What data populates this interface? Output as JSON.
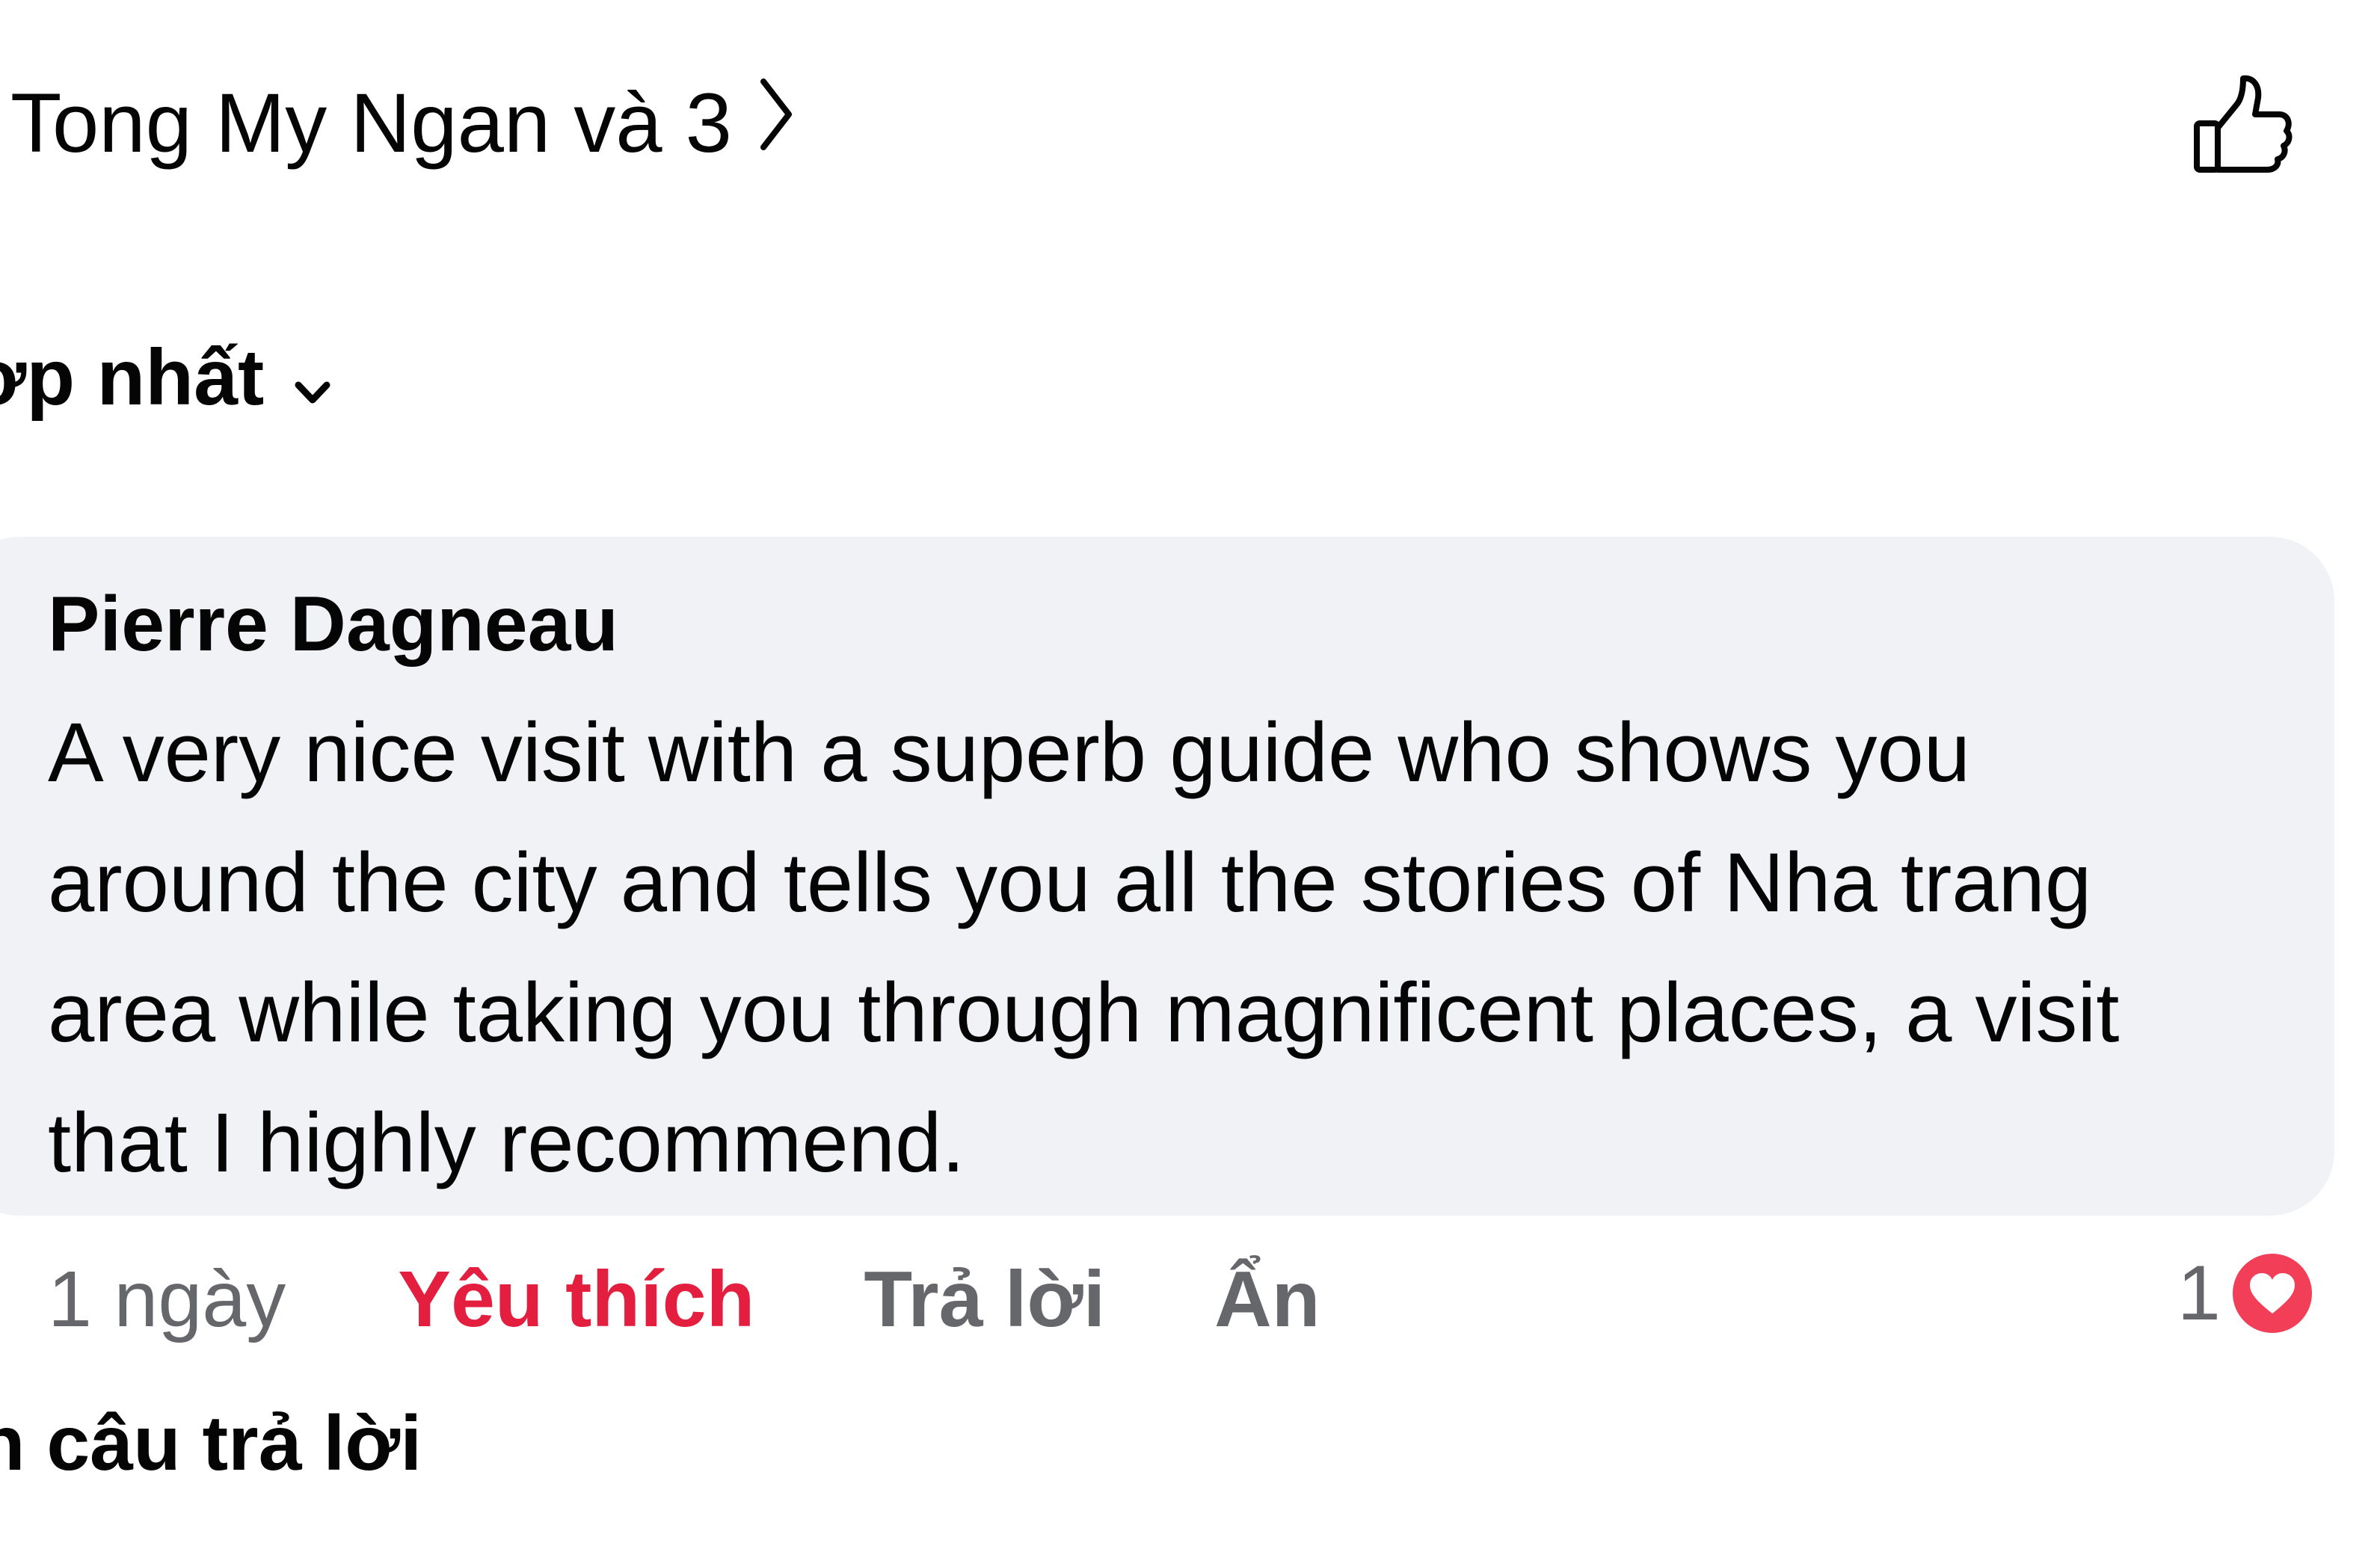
{
  "reactions_header": {
    "text": "Tong My Ngan và 3",
    "chevron_icon": "chevron-right-icon",
    "like_icon": "thumbs-up-outline-icon"
  },
  "sort": {
    "label": "ợp nhất",
    "caret_icon": "chevron-down-icon"
  },
  "comment": {
    "author": "Pierre Dagneau",
    "text": "A very nice visit with a superb guide who shows you around the city and tells you all the stories of Nha trang area while taking you through magnificent places, a visit that I highly recommend.",
    "bubble_color": "#f0f2f5"
  },
  "comment_actions": {
    "time": "1 ngày",
    "like": "Yêu thích",
    "like_color": "#e41e3f",
    "reply": "Trả lời",
    "hide": "Ẩn",
    "reaction_count": "1",
    "reaction_icon": "heart-icon",
    "reaction_color": "#f33e58"
  },
  "view_replies": {
    "label": "n câu trả lời"
  }
}
